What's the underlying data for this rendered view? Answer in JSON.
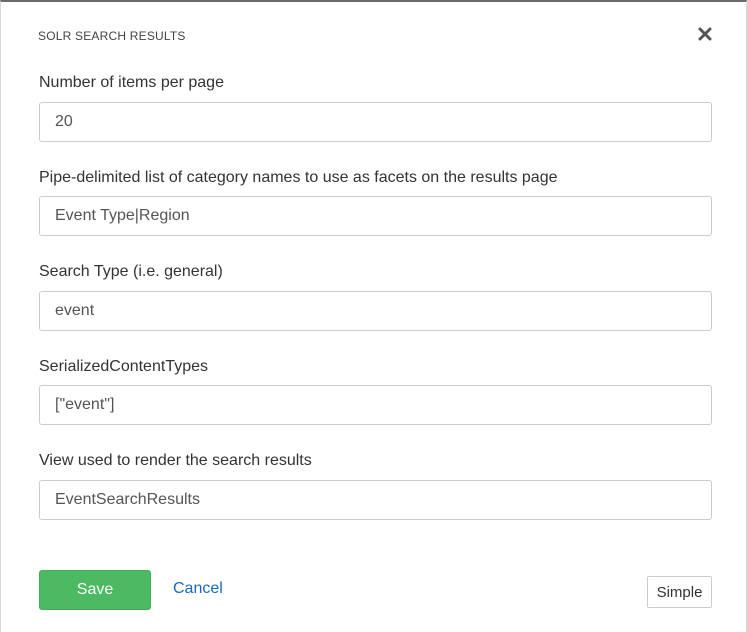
{
  "dialog": {
    "title": "SOLR SEARCH RESULTS",
    "close_icon": "close-icon"
  },
  "fields": [
    {
      "label": "Number of items per page",
      "value": "20"
    },
    {
      "label": "Pipe-delimited list of category names to use as facets on the results page",
      "value": "Event Type|Region"
    },
    {
      "label": "Search Type (i.e. general)",
      "value": "event"
    },
    {
      "label": "SerializedContentTypes",
      "value": "[\"event\"]"
    },
    {
      "label": "View used to render the search results",
      "value": "EventSearchResults"
    }
  ],
  "footer": {
    "save_label": "Save",
    "cancel_label": "Cancel",
    "simple_label": "Simple"
  },
  "colors": {
    "save_button": "#4cb963",
    "cancel_link": "#1a6aba"
  }
}
